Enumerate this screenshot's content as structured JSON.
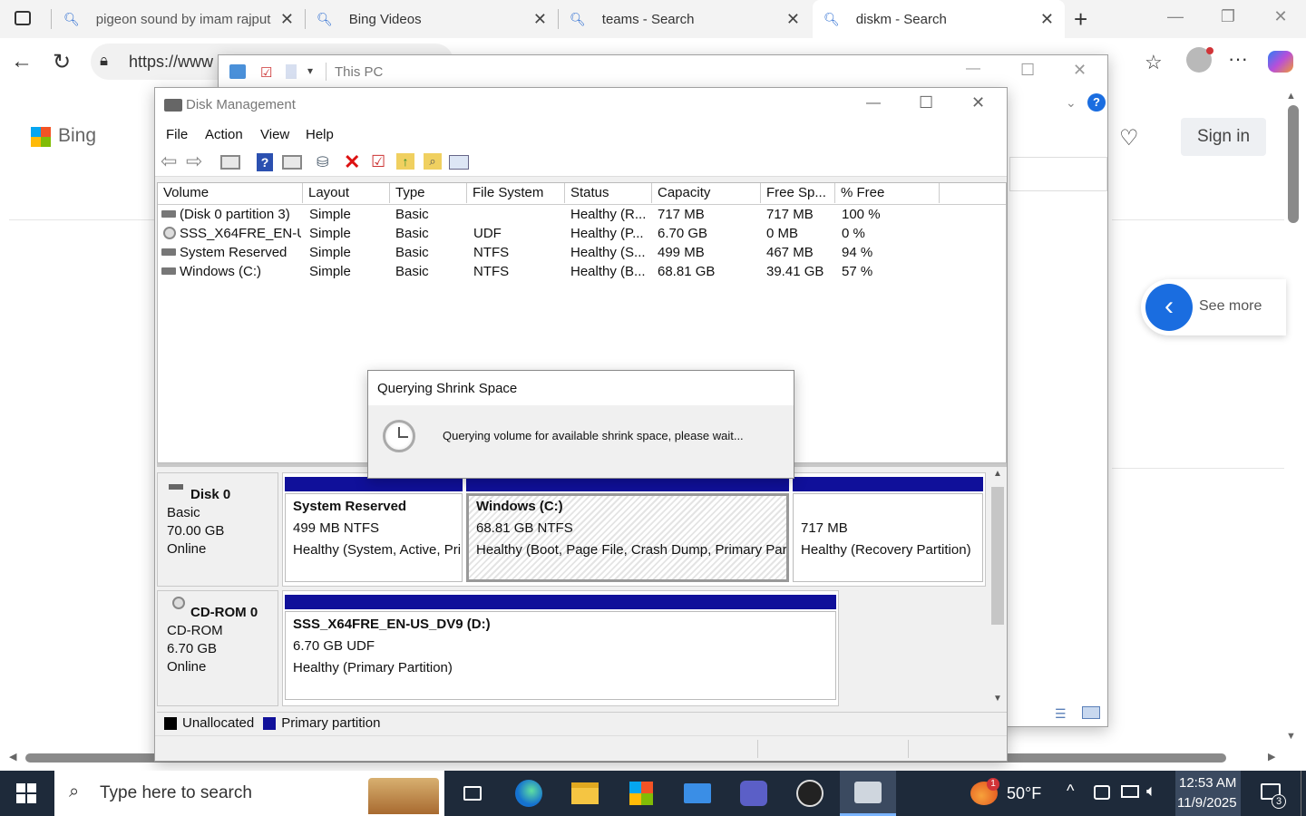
{
  "browser": {
    "tabs": [
      {
        "title": "pigeon sound by imam rajput"
      },
      {
        "title": "Bing Videos"
      },
      {
        "title": "teams - Search"
      },
      {
        "title": "diskm - Search"
      }
    ],
    "address": "https://www"
  },
  "bing": {
    "logo": "Bing",
    "sign_in": "Sign in",
    "see_more": "See more"
  },
  "explorer": {
    "title": "This PC"
  },
  "diskmgmt": {
    "title": "Disk Management",
    "menu": [
      "File",
      "Action",
      "View",
      "Help"
    ],
    "columns": [
      "Volume",
      "Layout",
      "Type",
      "File System",
      "Status",
      "Capacity",
      "Free Sp...",
      "% Free"
    ],
    "rows": [
      {
        "volume": "(Disk 0 partition 3)",
        "layout": "Simple",
        "type": "Basic",
        "fs": "",
        "status": "Healthy (R...",
        "capacity": "717 MB",
        "free": "717 MB",
        "pct": "100 %"
      },
      {
        "volume": "SSS_X64FRE_EN-U...",
        "layout": "Simple",
        "type": "Basic",
        "fs": "UDF",
        "status": "Healthy (P...",
        "capacity": "6.70 GB",
        "free": "0 MB",
        "pct": "0 %"
      },
      {
        "volume": "System Reserved",
        "layout": "Simple",
        "type": "Basic",
        "fs": "NTFS",
        "status": "Healthy (S...",
        "capacity": "499 MB",
        "free": "467 MB",
        "pct": "94 %"
      },
      {
        "volume": "Windows (C:)",
        "layout": "Simple",
        "type": "Basic",
        "fs": "NTFS",
        "status": "Healthy (B...",
        "capacity": "68.81 GB",
        "free": "39.41 GB",
        "pct": "57 %"
      }
    ],
    "disk0": {
      "name": "Disk 0",
      "type": "Basic",
      "size": "70.00 GB",
      "state": "Online"
    },
    "disk0_parts": [
      {
        "name": "System Reserved",
        "size": "499 MB NTFS",
        "status": "Healthy (System, Active, Pri"
      },
      {
        "name": "Windows  (C:)",
        "size": "68.81 GB NTFS",
        "status": "Healthy (Boot, Page File, Crash Dump, Primary Parti"
      },
      {
        "name": "",
        "size": "717 MB",
        "status": "Healthy (Recovery Partition)"
      }
    ],
    "cdrom": {
      "name": "CD-ROM 0",
      "type": "CD-ROM",
      "size": "6.70 GB",
      "state": "Online"
    },
    "cdrom_part": {
      "name": "SSS_X64FRE_EN-US_DV9  (D:)",
      "size": "6.70 GB UDF",
      "status": "Healthy (Primary Partition)"
    },
    "legend": [
      "Unallocated",
      "Primary partition"
    ]
  },
  "dialog": {
    "title": "Querying Shrink Space",
    "message": "Querying volume for available shrink space, please wait..."
  },
  "taskbar": {
    "search_placeholder": "Type here to search",
    "weather": "50°F",
    "weather_badge": "1",
    "time": "12:53 AM",
    "date": "11/9/2025",
    "notifications": "3"
  },
  "colors": {
    "primary_partition": "#10109a",
    "unallocated": "#000000",
    "taskbar": "#1e2a3a"
  }
}
